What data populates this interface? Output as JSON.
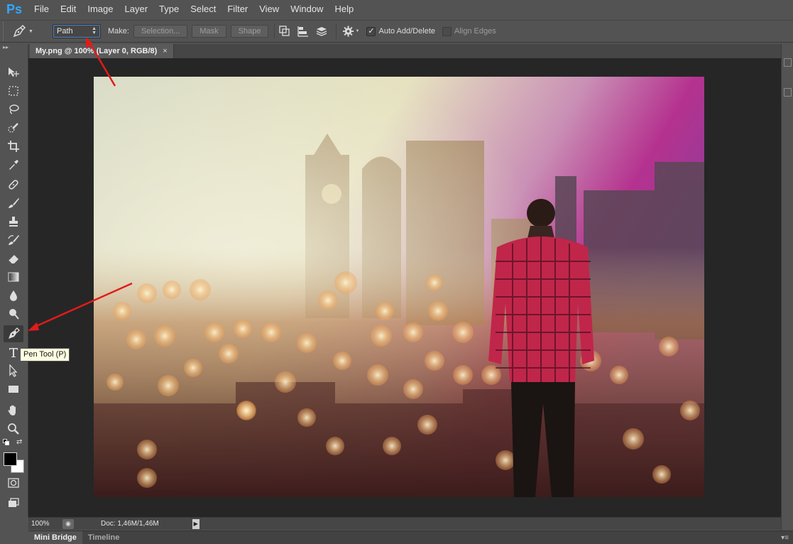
{
  "app": {
    "logo": "Ps"
  },
  "menu": [
    "File",
    "Edit",
    "Image",
    "Layer",
    "Type",
    "Select",
    "Filter",
    "View",
    "Window",
    "Help"
  ],
  "options": {
    "mode_value": "Path",
    "make_label": "Make:",
    "selection_button": "Selection...",
    "mask_button": "Mask",
    "shape_button": "Shape",
    "auto_add_delete_label": "Auto Add/Delete",
    "auto_add_delete_checked": true,
    "align_edges_label": "Align Edges",
    "align_edges_checked": false
  },
  "tools": [
    "move-tool-icon",
    "marquee-tool-icon",
    "lasso-tool-icon",
    "quick-selection-tool-icon",
    "crop-tool-icon",
    "eyedropper-tool-icon",
    "healing-brush-tool-icon",
    "brush-tool-icon",
    "clone-stamp-tool-icon",
    "history-brush-tool-icon",
    "eraser-tool-icon",
    "gradient-tool-icon",
    "blur-tool-icon",
    "dodge-tool-icon",
    "pen-tool-icon",
    "type-tool-icon",
    "path-selection-tool-icon",
    "rectangle-tool-icon",
    "hand-tool-icon",
    "zoom-tool-icon"
  ],
  "active_tool": "pen-tool-icon",
  "tooltip": "Pen Tool (P)",
  "colors": {
    "foreground": "#000000",
    "background": "#ffffff",
    "accent": "#31a8ff",
    "arrow": "#e11b1b"
  },
  "document": {
    "tab_title": "My.png @ 100% (Layer 0, RGB/8)",
    "close_glyph": "×"
  },
  "status": {
    "zoom": "100%",
    "doc_info": "Doc: 1,46M/1,46M"
  },
  "bottom_tabs": [
    "Mini Bridge",
    "Timeline"
  ]
}
